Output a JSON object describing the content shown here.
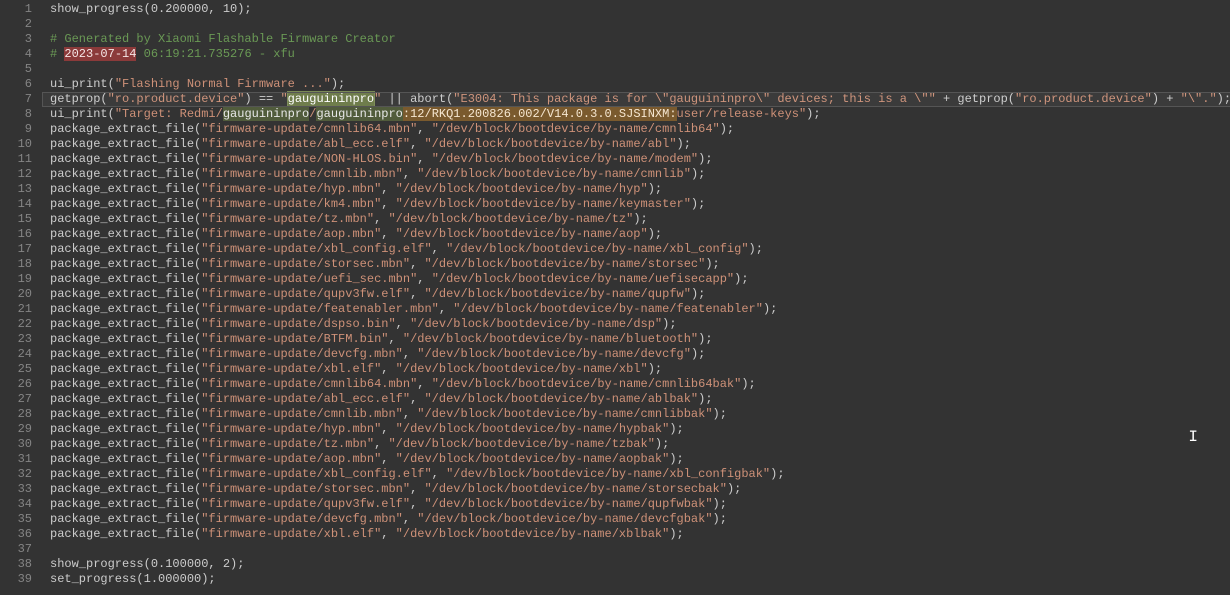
{
  "line_count": 39,
  "comments": {
    "gen": "# Generated by Xiaomi Flashable Firmware Creator",
    "date_prefix": "# ",
    "date": "2023-07-14",
    "date_suffix": " 06:19:21.735276 - xfu"
  },
  "highlights": {
    "match": "gauguininpro",
    "build": ":12/RKQ1.200826.002/V14.0.3.0.SJSINXM:"
  },
  "lines": {
    "l1": "show_progress(0.200000, 10);",
    "l4": "",
    "l6a": "ui_print(",
    "l6b": "\"Flashing Normal Firmware ...\"",
    "l6c": ");",
    "l7a": "getprop(",
    "l7b": "\"ro.product.device\"",
    "l7c": ") == ",
    "l7d": "\"",
    "l7e": "\"",
    "l7f": " || abort(",
    "l7g": "\"E3004: This package is for \\\"gauguininpro\\\" devices; this is a \\\"\"",
    "l7h": " + getprop(",
    "l7i": "\"ro.product.device\"",
    "l7j": ") + ",
    "l7k": "\"\\\".\"",
    "l7l": ");",
    "l8a": "ui_print(",
    "l8b": "\"Target: Redmi/",
    "l8c": "/",
    "l8d": "user/release-keys\"",
    "l8e": ");",
    "l38": "show_progress(0.100000, 2);",
    "l39": "set_progress(1.000000);"
  },
  "pef": [
    {
      "f": "firmware-update/cmnlib64.mbn",
      "p": "/dev/block/bootdevice/by-name/cmnlib64"
    },
    {
      "f": "firmware-update/abl_ecc.elf",
      "p": "/dev/block/bootdevice/by-name/abl"
    },
    {
      "f": "firmware-update/NON-HLOS.bin",
      "p": "/dev/block/bootdevice/by-name/modem"
    },
    {
      "f": "firmware-update/cmnlib.mbn",
      "p": "/dev/block/bootdevice/by-name/cmnlib"
    },
    {
      "f": "firmware-update/hyp.mbn",
      "p": "/dev/block/bootdevice/by-name/hyp"
    },
    {
      "f": "firmware-update/km4.mbn",
      "p": "/dev/block/bootdevice/by-name/keymaster"
    },
    {
      "f": "firmware-update/tz.mbn",
      "p": "/dev/block/bootdevice/by-name/tz"
    },
    {
      "f": "firmware-update/aop.mbn",
      "p": "/dev/block/bootdevice/by-name/aop"
    },
    {
      "f": "firmware-update/xbl_config.elf",
      "p": "/dev/block/bootdevice/by-name/xbl_config"
    },
    {
      "f": "firmware-update/storsec.mbn",
      "p": "/dev/block/bootdevice/by-name/storsec"
    },
    {
      "f": "firmware-update/uefi_sec.mbn",
      "p": "/dev/block/bootdevice/by-name/uefisecapp"
    },
    {
      "f": "firmware-update/qupv3fw.elf",
      "p": "/dev/block/bootdevice/by-name/qupfw"
    },
    {
      "f": "firmware-update/featenabler.mbn",
      "p": "/dev/block/bootdevice/by-name/featenabler"
    },
    {
      "f": "firmware-update/dspso.bin",
      "p": "/dev/block/bootdevice/by-name/dsp"
    },
    {
      "f": "firmware-update/BTFM.bin",
      "p": "/dev/block/bootdevice/by-name/bluetooth"
    },
    {
      "f": "firmware-update/devcfg.mbn",
      "p": "/dev/block/bootdevice/by-name/devcfg"
    },
    {
      "f": "firmware-update/xbl.elf",
      "p": "/dev/block/bootdevice/by-name/xbl"
    },
    {
      "f": "firmware-update/cmnlib64.mbn",
      "p": "/dev/block/bootdevice/by-name/cmnlib64bak"
    },
    {
      "f": "firmware-update/abl_ecc.elf",
      "p": "/dev/block/bootdevice/by-name/ablbak"
    },
    {
      "f": "firmware-update/cmnlib.mbn",
      "p": "/dev/block/bootdevice/by-name/cmnlibbak"
    },
    {
      "f": "firmware-update/hyp.mbn",
      "p": "/dev/block/bootdevice/by-name/hypbak"
    },
    {
      "f": "firmware-update/tz.mbn",
      "p": "/dev/block/bootdevice/by-name/tzbak"
    },
    {
      "f": "firmware-update/aop.mbn",
      "p": "/dev/block/bootdevice/by-name/aopbak"
    },
    {
      "f": "firmware-update/xbl_config.elf",
      "p": "/dev/block/bootdevice/by-name/xbl_configbak"
    },
    {
      "f": "firmware-update/storsec.mbn",
      "p": "/dev/block/bootdevice/by-name/storsecbak"
    },
    {
      "f": "firmware-update/qupv3fw.elf",
      "p": "/dev/block/bootdevice/by-name/qupfwbak"
    },
    {
      "f": "firmware-update/devcfg.mbn",
      "p": "/dev/block/bootdevice/by-name/devcfgbak"
    },
    {
      "f": "firmware-update/xbl.elf",
      "p": "/dev/block/bootdevice/by-name/xblbak"
    }
  ],
  "cursor_glyph": "I"
}
